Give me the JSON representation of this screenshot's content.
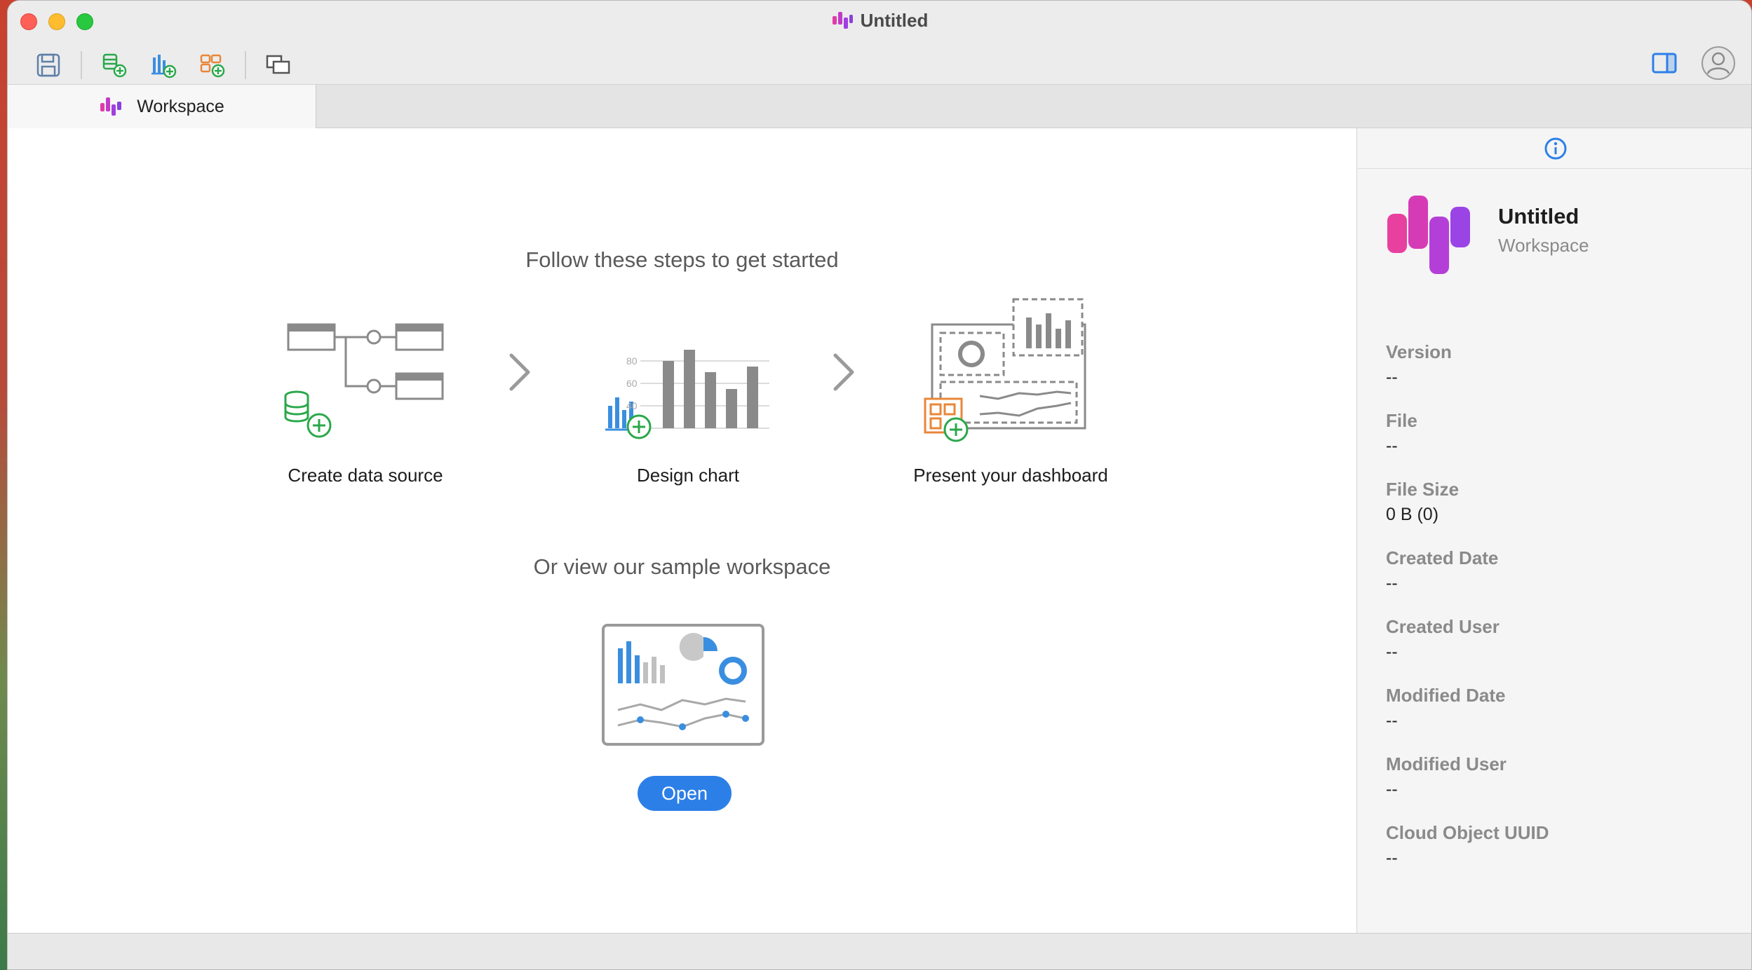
{
  "window": {
    "title": "Untitled"
  },
  "tabs": [
    {
      "label": "Workspace"
    }
  ],
  "main": {
    "heading": "Follow these steps to get started",
    "steps": [
      {
        "label": "Create data source"
      },
      {
        "label": "Design chart"
      },
      {
        "label": "Present your dashboard"
      }
    ],
    "chart_axis_ticks": [
      "80",
      "60",
      "40"
    ],
    "sample_heading": "Or view our sample workspace",
    "open_label": "Open"
  },
  "sidebar": {
    "title": "Untitled",
    "subtitle": "Workspace",
    "properties": [
      {
        "label": "Version",
        "value": "--"
      },
      {
        "label": "File",
        "value": "--"
      },
      {
        "label": "File Size",
        "value": "0 B (0)"
      },
      {
        "label": "Created Date",
        "value": "--"
      },
      {
        "label": "Created User",
        "value": "--"
      },
      {
        "label": "Modified Date",
        "value": "--"
      },
      {
        "label": "Modified User",
        "value": "--"
      },
      {
        "label": "Cloud Object UUID",
        "value": "--"
      }
    ]
  },
  "colors": {
    "accent": "#2d7fe8",
    "brand_magenta": "#e03ca8",
    "brand_purple": "#9a3fe0",
    "green": "#2aa84a",
    "orange": "#e8873a"
  },
  "icons": {
    "toolbar": [
      "save-icon",
      "add-data-source-icon",
      "add-chart-icon",
      "add-dashboard-icon",
      "window-icon"
    ],
    "right": [
      "sidebar-toggle-icon",
      "user-avatar-icon"
    ],
    "side_header": "info-icon"
  }
}
